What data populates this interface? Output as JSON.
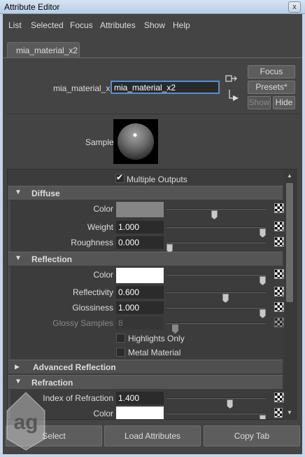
{
  "window": {
    "title": "Attribute Editor",
    "close_label": "x"
  },
  "menu": [
    "List",
    "Selected",
    "Focus",
    "Attributes",
    "Show",
    "Help"
  ],
  "tab": {
    "label": "mia_material_x2"
  },
  "node": {
    "label": "mia_material_x:",
    "value": "mia_material_x2",
    "focus_label": "Focus",
    "presets_label": "Presets*",
    "show_label": "Show",
    "hide_label": "Hide"
  },
  "sample": {
    "label": "Sample"
  },
  "multiple_outputs": {
    "label": "Multiple Outputs",
    "checked": true
  },
  "sections": {
    "diffuse": {
      "title": "Diffuse",
      "rows": {
        "color": {
          "label": "Color",
          "color": "#858585",
          "slider": 0.48
        },
        "weight": {
          "label": "Weight",
          "value": "1.000",
          "slider": 1.0
        },
        "roughness": {
          "label": "Roughness",
          "value": "0.000",
          "slider": 0.0
        }
      }
    },
    "reflection": {
      "title": "Reflection",
      "rows": {
        "color": {
          "label": "Color",
          "color": "#ffffff",
          "slider": 1.0
        },
        "reflectivity": {
          "label": "Reflectivity",
          "value": "0.600",
          "slider": 0.6
        },
        "glossiness": {
          "label": "Glossiness",
          "value": "1.000",
          "slider": 1.0
        },
        "glossy_samples": {
          "label": "Glossy Samples",
          "value": "8",
          "slider": 0.06
        }
      },
      "highlights_only": {
        "label": "Highlights Only",
        "checked": false
      },
      "metal_material": {
        "label": "Metal Material",
        "checked": false
      }
    },
    "advanced_reflection": {
      "title": "Advanced Reflection"
    },
    "refraction": {
      "title": "Refraction",
      "rows": {
        "ior": {
          "label": "Index of Refraction",
          "value": "1.400",
          "slider": 0.65
        },
        "color": {
          "label": "Color",
          "color": "#ffffff",
          "slider": 1.0
        }
      }
    }
  },
  "bottom_buttons": {
    "select": "Select",
    "load": "Load Attributes",
    "copy": "Copy Tab"
  },
  "colors": {
    "accent": "#5a8ed2",
    "panel": "#444444",
    "section": "#555555"
  }
}
